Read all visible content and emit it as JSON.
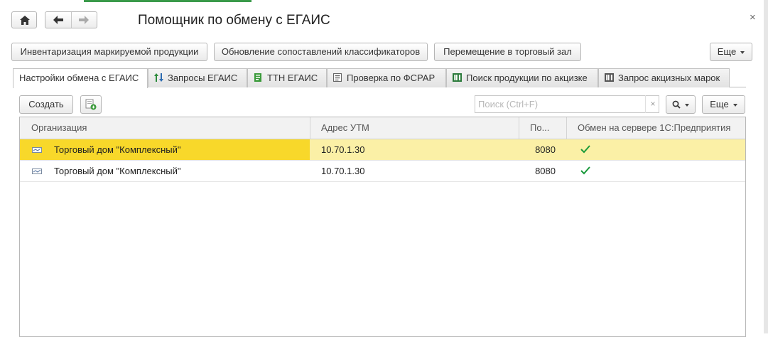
{
  "window": {
    "title": "Помощник по обмену с ЕГАИС",
    "close_symbol": "×"
  },
  "commands": {
    "inventory": "Инвентаризация маркируемой продукции",
    "update_mapping": "Обновление сопоставлений классификаторов",
    "move_to_hall": "Перемещение в торговый зал",
    "more": "Еще"
  },
  "tabs": [
    {
      "label": "Настройки обмена с ЕГАИС",
      "icon": "none",
      "active": true
    },
    {
      "label": "Запросы ЕГАИС",
      "icon": "arrows-up-down-icon"
    },
    {
      "label": "ТТН ЕГАИС",
      "icon": "document-green-icon"
    },
    {
      "label": "Проверка по ФСРАР",
      "icon": "checklist-icon"
    },
    {
      "label": "Поиск продукции по акцизке",
      "icon": "barcode-search-icon"
    },
    {
      "label": "Запрос акцизных марок",
      "icon": "barcode-icon"
    }
  ],
  "toolbar": {
    "create": "Создать",
    "search_placeholder": "Поиск (Ctrl+F)",
    "search_value": "",
    "clear": "×",
    "more": "Еще"
  },
  "table": {
    "columns": [
      "Организация",
      "Адрес УТМ",
      "По...",
      "Обмен на сервере 1С:Предприятия"
    ],
    "rows": [
      {
        "org": "Торговый дом \"Комплексный\"",
        "address": "10.70.1.30",
        "port": "8080",
        "server_exchange": true,
        "selected": true
      },
      {
        "org": "Торговый дом \"Комплексный\"",
        "address": "10.70.1.30",
        "port": "8080",
        "server_exchange": true,
        "selected": false
      }
    ]
  },
  "colors": {
    "selected_row": "#fbf0a6",
    "selected_cell": "#f8d82a",
    "check": "#1a9a3a",
    "accent_strip": "#3a9a4a"
  }
}
